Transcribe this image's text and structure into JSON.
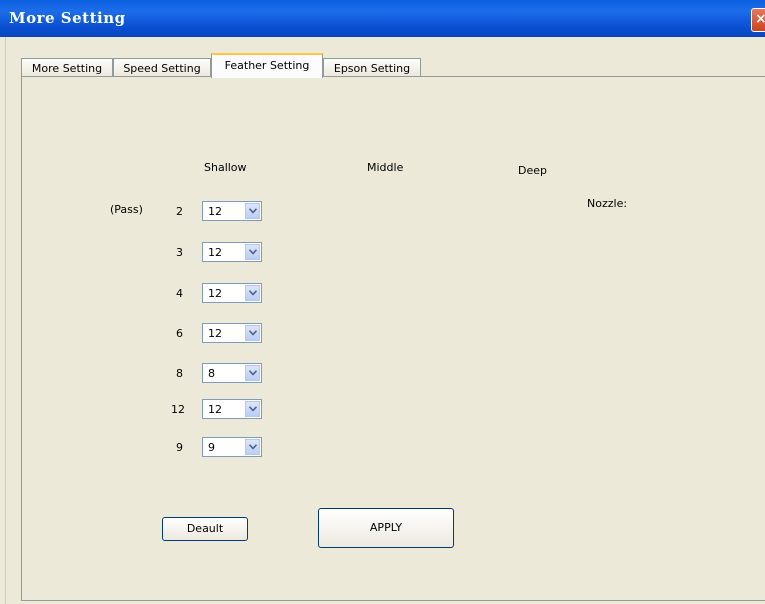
{
  "window": {
    "title": "More Setting"
  },
  "tabs": [
    {
      "label": "More Setting"
    },
    {
      "label": "Speed Setting"
    },
    {
      "label": "Feather Setting"
    },
    {
      "label": "Epson Setting"
    }
  ],
  "active_tab": "Feather Setting",
  "columns": {
    "shallow": "Shallow",
    "middle": "Middle",
    "deep": "Deep"
  },
  "pass_label": "(Pass)",
  "nozzle_label": "Nozzle:",
  "rows": [
    {
      "pass": "2",
      "shallow_value": "12"
    },
    {
      "pass": "3",
      "shallow_value": "12"
    },
    {
      "pass": "4",
      "shallow_value": "12"
    },
    {
      "pass": "6",
      "shallow_value": "12"
    },
    {
      "pass": "8",
      "shallow_value": "8"
    },
    {
      "pass": "12",
      "shallow_value": "12"
    },
    {
      "pass": "9",
      "shallow_value": "9"
    }
  ],
  "buttons": {
    "default": "Deault",
    "apply": "APPLY"
  },
  "icons": {
    "close": "close-icon",
    "dropdown": "chevron-down-icon"
  },
  "colors": {
    "titlebar": "#0a5fe0",
    "face": "#ece9d8",
    "active_tab_accent": "#ffc83c"
  }
}
